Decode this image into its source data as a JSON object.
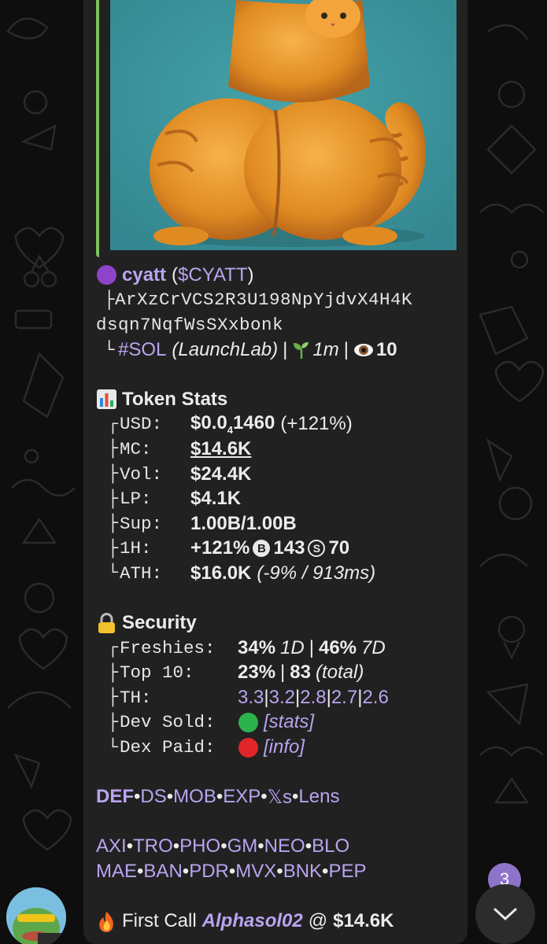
{
  "token": {
    "name": "cyatt",
    "ticker": "($CYATT)",
    "address_line1": "ArXzCrVCS2R3U198NpYjdvX4H4K",
    "address_line2": "dsqn7NqfWsSXxbonk",
    "chain": "#SOL",
    "launchpad": "(LaunchLab)",
    "sep": "|",
    "age": "1m",
    "views": "10"
  },
  "token_stats": {
    "title": "Token Stats",
    "usd_key": "USD:",
    "usd_prefix": "$0.0",
    "usd_sub": "4",
    "usd_rest": "1460",
    "usd_change": "(+121%)",
    "mc_key": "MC:",
    "mc": "$14.6K",
    "vol_key": "Vol:",
    "vol": "$24.4K",
    "lp_key": "LP:",
    "lp": "$4.1K",
    "sup_key": "Sup:",
    "sup": "1.00B/1.00B",
    "h1_key": "1H:",
    "h1_change": "+121%",
    "h1_buys_icon": "B",
    "h1_buys": "143",
    "h1_sells_icon": "S",
    "h1_sells": "70",
    "ath_key": "ATH:",
    "ath": "$16.0K",
    "ath_note": "(-9% / 913ms)"
  },
  "security": {
    "title": "Security",
    "freshies_key": "Freshies:",
    "freshies_1d": "34%",
    "freshies_1d_label": "1D",
    "freshies_7d": "46%",
    "freshies_7d_label": "7D",
    "top10_key": "Top 10:",
    "top10_pct": "23%",
    "top10_count": "83",
    "top10_label": "(total)",
    "th_key": "TH:",
    "th_values": [
      "3.3",
      "3.2",
      "2.8",
      "2.7",
      "2.6"
    ],
    "dev_sold_key": "Dev Sold:",
    "dev_sold_link": "[stats]",
    "dev_sold_status_color": "#2bb24c",
    "dex_paid_key": "Dex Paid:",
    "dex_paid_link": "[info]",
    "dex_paid_status_color": "#e0262b"
  },
  "links_row1": [
    "DEF",
    "DS",
    "MOB",
    "EXP",
    "𝕏s",
    "Lens"
  ],
  "links_row2": [
    "AXI",
    "TRO",
    "PHO",
    "GM",
    "NEO",
    "BLO"
  ],
  "links_row3": [
    "MAE",
    "BAN",
    "PDR",
    "MVX",
    "BNK",
    "PEP"
  ],
  "first_call": {
    "label": "First Call",
    "user": "Alphasol02",
    "at": "@",
    "value": "$14.6K"
  },
  "unread_count": "3",
  "colors": {
    "accent_link": "#b9a4f0",
    "media_bar": "#7cc15c",
    "bubble": "#212121",
    "badge": "#8e74c9"
  }
}
